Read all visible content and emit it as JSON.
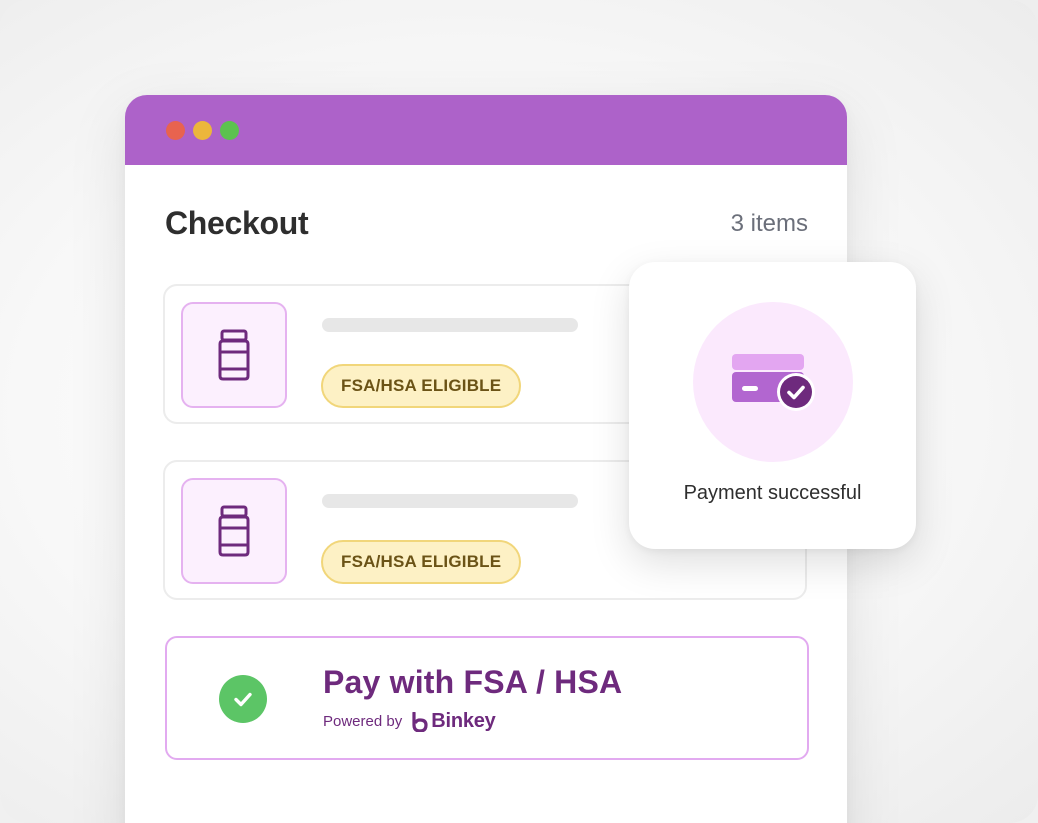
{
  "window": {
    "title_bar_dots": [
      "close",
      "minimize",
      "maximize"
    ],
    "accent_color": "#ad62c9"
  },
  "checkout": {
    "title": "Checkout",
    "item_count": "3 items"
  },
  "items": [
    {
      "icon": "jar-icon",
      "badge": "FSA/HSA ELIGIBLE"
    },
    {
      "icon": "jar-icon",
      "badge": "FSA/HSA ELIGIBLE"
    }
  ],
  "payment": {
    "title": "Pay with FSA / HSA",
    "powered_by": "Powered by",
    "provider": "Binkey",
    "check_color": "#5cc566",
    "text_color": "#6e2a7d"
  },
  "popup": {
    "icon": "card-check-icon",
    "message": "Payment successful"
  },
  "colors": {
    "badge_bg": "#fdf1c5",
    "badge_border": "#f1d67a",
    "thumb_bg": "#fcf0fe",
    "thumb_border": "#e5b2f0"
  }
}
